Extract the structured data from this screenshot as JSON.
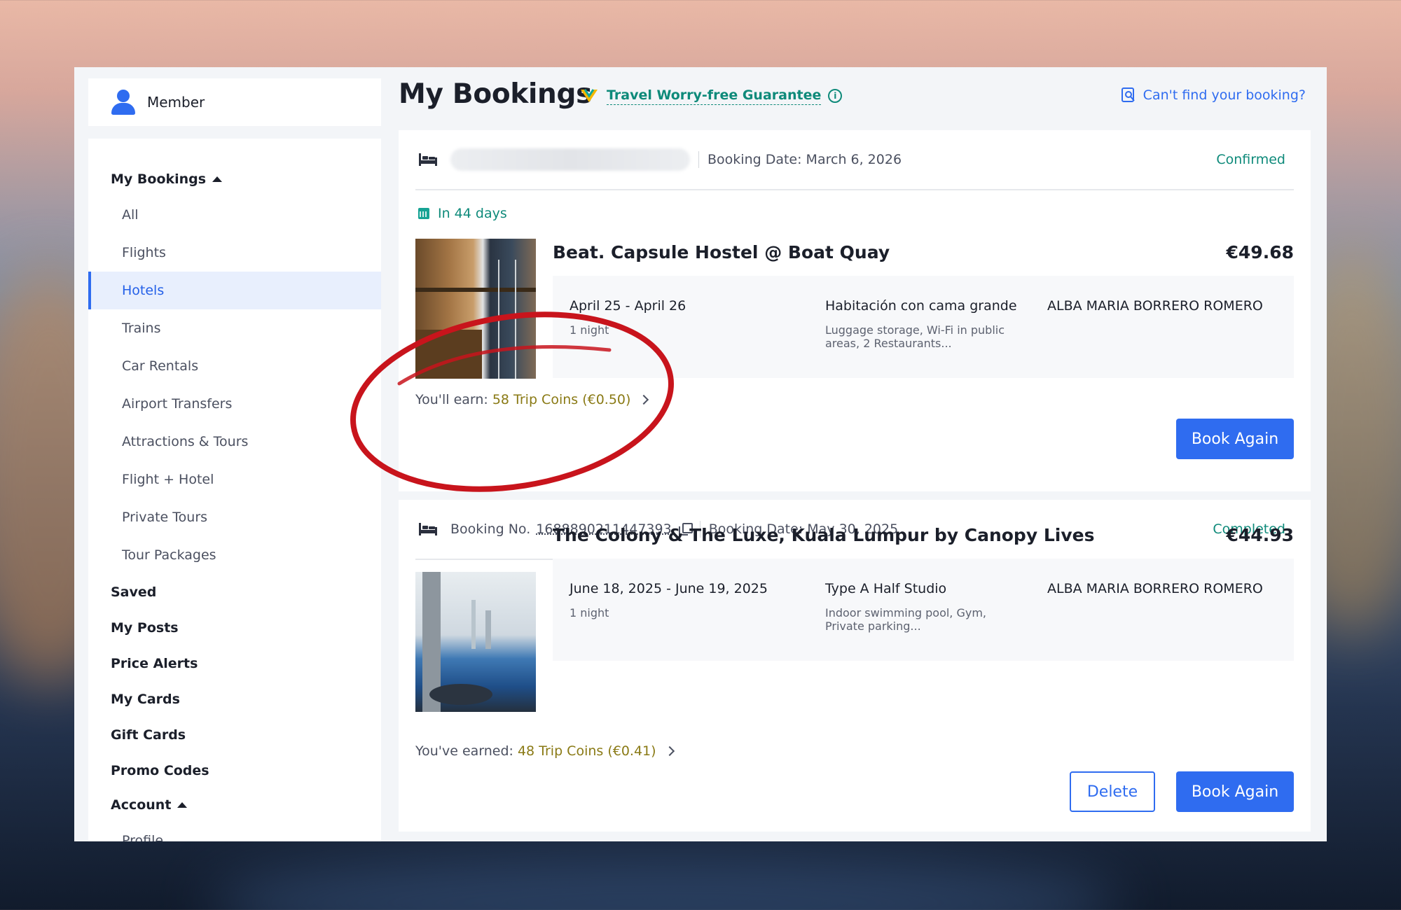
{
  "member": {
    "label": "Member"
  },
  "sidebar": {
    "my_bookings": "My Bookings",
    "items": [
      "All",
      "Flights",
      "Hotels",
      "Trains",
      "Car Rentals",
      "Airport Transfers",
      "Attractions & Tours",
      "Flight + Hotel",
      "Private Tours",
      "Tour Packages"
    ],
    "active_item": "Hotels",
    "top_items": [
      "Saved",
      "My Posts",
      "Price Alerts",
      "My Cards",
      "Gift Cards",
      "Promo Codes"
    ],
    "account": "Account",
    "account_items": [
      "Profile"
    ]
  },
  "header": {
    "title": "My Bookings",
    "guarantee": "Travel Worry-free Guarantee",
    "cant_find": "Can't find your booking?"
  },
  "bookings": [
    {
      "booking_date": "Booking Date: March 6, 2026",
      "status": "Confirmed",
      "countdown": "In 44 days",
      "hotel": "Beat. Capsule Hostel @ Boat Quay",
      "price": "€49.68",
      "dates": "April 25 - April 26",
      "nights": "1 night",
      "room": "Habitación con cama grande",
      "amenities_1": "Luggage storage, Wi-Fi in public",
      "amenities_2": "areas, 2 Restaurants...",
      "guest": "ALBA MARIA BORRERO ROMERO",
      "earn_label": "You'll earn:",
      "coins": "58 Trip Coins (€0.50)",
      "book_again": "Book Again"
    },
    {
      "booking_no_label": "Booking No.",
      "booking_no": "1688890211447393",
      "booking_date": "Booking Date: May 30, 2025",
      "status": "Completed",
      "hotel": "The Colony & The Luxe, Kuala Lumpur by Canopy Lives",
      "price": "€44.93",
      "dates": "June 18, 2025 - June 19, 2025",
      "nights": "1 night",
      "room": "Type A Half Studio",
      "amenities_1": "Indoor swimming pool, Gym,",
      "amenities_2": "Private parking...",
      "guest": "ALBA MARIA BORRERO ROMERO",
      "earn_label": "You've earned:",
      "coins": "48 Trip Coins (€0.41)",
      "delete": "Delete",
      "book_again": "Book Again"
    }
  ],
  "colors": {
    "accent": "#2f6cf0",
    "teal": "#0e8a7a",
    "coin": "#8a7a15",
    "annotation": "#c8141c"
  }
}
